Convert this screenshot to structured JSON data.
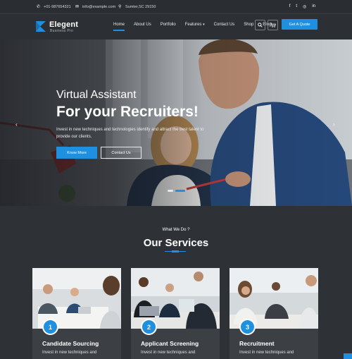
{
  "topbar": {
    "phone": "+01-987654321",
    "email": "info@example.com",
    "address": "Sumter,SC 29150",
    "social": [
      {
        "icon": "facebook-icon",
        "glyph": "f"
      },
      {
        "icon": "twitter-icon",
        "glyph": "t"
      },
      {
        "icon": "instagram-icon",
        "glyph": "◎"
      },
      {
        "icon": "linkedin-icon",
        "glyph": "in"
      }
    ]
  },
  "brand": {
    "name": "Elegent",
    "tagline": "Business Pro",
    "accent": "#1e90df"
  },
  "nav": {
    "items": [
      "Home",
      "About Us",
      "Portfolio",
      "Features",
      "Contact Us",
      "Shop",
      "Blog"
    ],
    "active": "Home",
    "quote_label": "Get A Quote"
  },
  "hero": {
    "subtitle": "Virtual Assistant",
    "title": "For your Recruiters!",
    "text": "Invest in new techniques and technologies identify and attract the best talent to provide our clients.",
    "primary_label": "Know More",
    "secondary_label": "Contact Us",
    "prev_glyph": "‹",
    "next_glyph": "›"
  },
  "services": {
    "kicker": "What We Do ?",
    "title": "Our Services",
    "cards": [
      {
        "num": "1",
        "title": "Candidate Sourcing",
        "text": "Invest in new techniques and"
      },
      {
        "num": "2",
        "title": "Applicant Screening",
        "text": "Invest in new techniques and"
      },
      {
        "num": "3",
        "title": "Recruitment",
        "text": "Invest in new techniques and"
      }
    ]
  }
}
